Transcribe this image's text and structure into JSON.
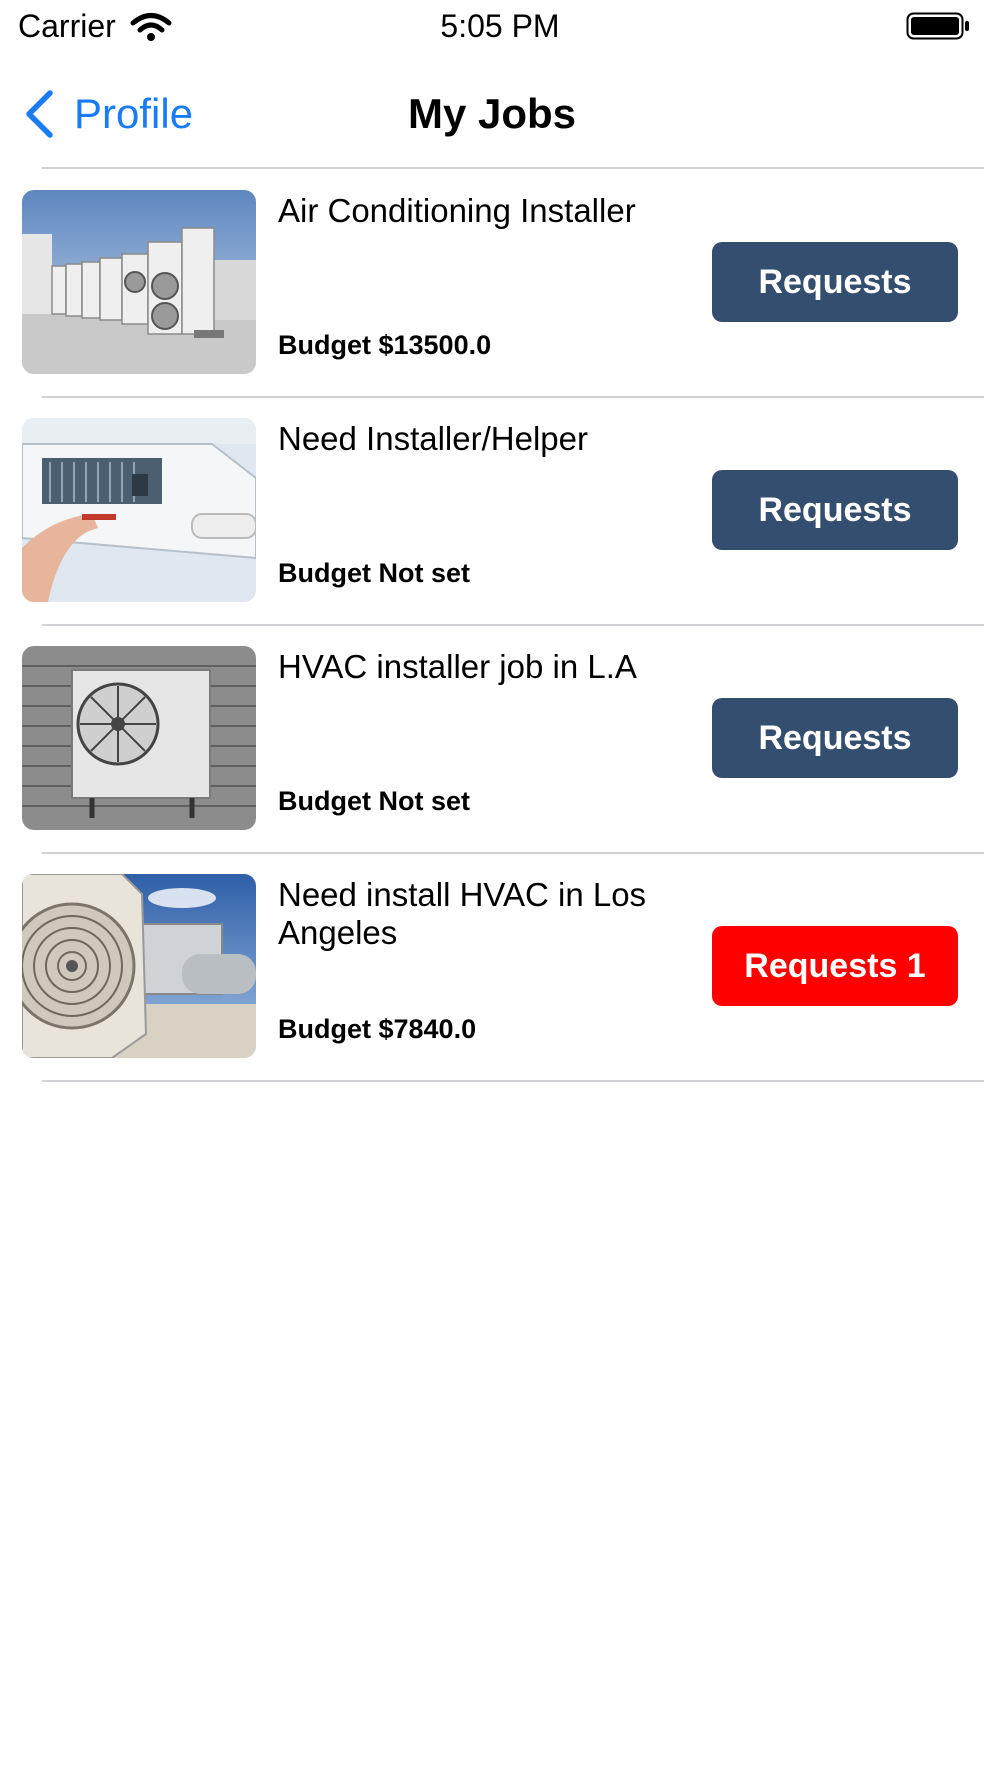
{
  "status_bar": {
    "carrier": "Carrier",
    "time": "5:05 PM"
  },
  "nav": {
    "back_label": "Profile",
    "title": "My Jobs"
  },
  "jobs": [
    {
      "title": "Air Conditioning Installer",
      "budget": "Budget $13500.0",
      "requests_label": "Requests",
      "image": "rooftop-ac-units-row"
    },
    {
      "title": "Need Installer/Helper",
      "budget": "Budget Not set",
      "requests_label": "Requests",
      "image": "indoor-split-unit-repair"
    },
    {
      "title": "HVAC installer job in L.A",
      "budget": "Budget Not set",
      "requests_label": "Requests",
      "image": "wall-mounted-condenser"
    },
    {
      "title": "Need install HVAC in Los Angeles",
      "budget": "Budget $7840.0",
      "requests_label": "Requests 1",
      "image": "rooftop-condenser-fan"
    }
  ],
  "colors": {
    "accent": "#1a7cf5",
    "button": "#344e70",
    "button_alert": "#ff0000",
    "divider": "#d2d2d6"
  }
}
